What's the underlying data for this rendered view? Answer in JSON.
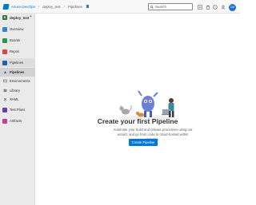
{
  "header": {
    "org_name": "Azure DevOps",
    "breadcrumbs": [
      "deploy_test",
      "Pipelines"
    ],
    "search_placeholder": "Search",
    "avatar_initials": "CM"
  },
  "sidebar": {
    "project_badge": "D",
    "project_name": "deploy_test",
    "items": [
      {
        "label": "Overview",
        "icon": "overview-icon",
        "color": "#2b88d8"
      },
      {
        "label": "Boards",
        "icon": "boards-icon",
        "color": "#2a9a4a"
      },
      {
        "label": "Repos",
        "icon": "repos-icon",
        "color": "#e0453c"
      },
      {
        "label": "Pipelines",
        "icon": "pipelines-icon",
        "color": "#2560b8"
      },
      {
        "label": "Pipelines",
        "icon": "pipelines-sub-icon",
        "color": "#2560b8"
      },
      {
        "label": "Environments",
        "icon": "environments-icon",
        "color": "#605e5c"
      },
      {
        "label": "Library",
        "icon": "library-icon",
        "color": "#605e5c"
      },
      {
        "label": "XAML",
        "icon": "xaml-icon",
        "color": "#605e5c"
      },
      {
        "label": "Test Plans",
        "icon": "test-plans-icon",
        "color": "#6a3fb5"
      },
      {
        "label": "Artifacts",
        "icon": "artifacts-icon",
        "color": "#c33d9a"
      }
    ]
  },
  "main": {
    "title": "Create your first Pipeline",
    "description": "Automate your build and release processes using our wizard, and go from code to cloud-hosted within minutes.",
    "create_button": "Create Pipeline"
  }
}
